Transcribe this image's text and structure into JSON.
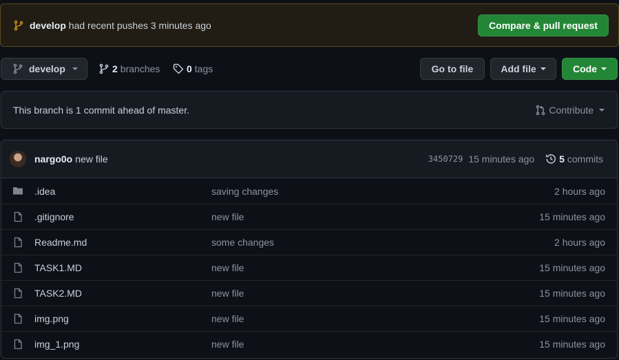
{
  "banner": {
    "branch": "develop",
    "message": "had recent pushes 3 minutes ago",
    "button": "Compare & pull request"
  },
  "toolbar": {
    "branch_select": "develop",
    "branches_count": "2",
    "branches_label": "branches",
    "tags_count": "0",
    "tags_label": "tags",
    "goto_file": "Go to file",
    "add_file": "Add file",
    "code": "Code"
  },
  "ahead": {
    "message": "This branch is 1 commit ahead of master.",
    "contribute": "Contribute"
  },
  "latest_commit": {
    "author": "nargo0o",
    "message": "new file",
    "sha": "3450729",
    "time": "15 minutes ago",
    "commits_count": "5",
    "commits_label": "commits"
  },
  "files": [
    {
      "name": ".idea",
      "type": "folder",
      "commit": "saving changes",
      "age": "2 hours ago"
    },
    {
      "name": ".gitignore",
      "type": "file",
      "commit": "new file",
      "age": "15 minutes ago"
    },
    {
      "name": "Readme.md",
      "type": "file",
      "commit": "some changes",
      "age": "2 hours ago"
    },
    {
      "name": "TASK1.MD",
      "type": "file",
      "commit": "new file",
      "age": "15 minutes ago"
    },
    {
      "name": "TASK2.MD",
      "type": "file",
      "commit": "new file",
      "age": "15 minutes ago"
    },
    {
      "name": "img.png",
      "type": "file",
      "commit": "new file",
      "age": "15 minutes ago"
    },
    {
      "name": "img_1.png",
      "type": "file",
      "commit": "new file",
      "age": "15 minutes ago"
    }
  ],
  "colors": {
    "background": "#0d1117",
    "banner_bg": "#211d14",
    "green_button": "#238636",
    "muted_text": "#8b949e"
  }
}
